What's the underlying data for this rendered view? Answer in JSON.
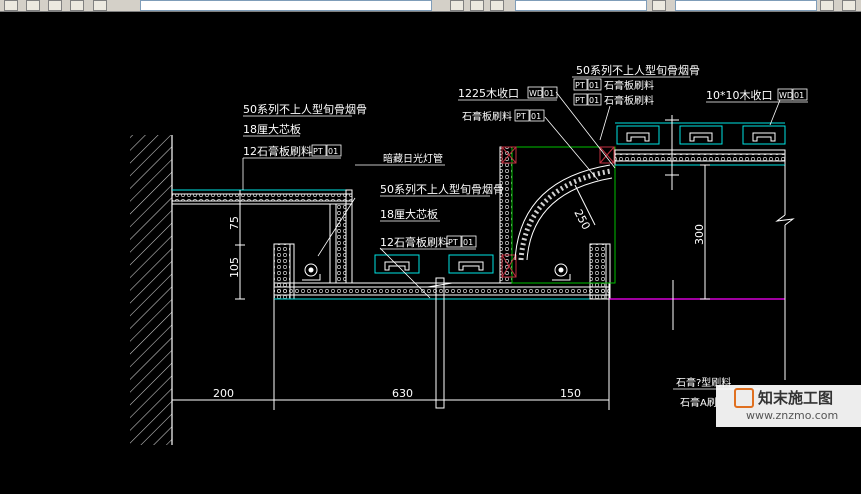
{
  "labels": {
    "left_keel": "50系列不上人型旬骨烟骨",
    "left_board": "18厘大芯板",
    "left_gypsum": "12石膏板刷料",
    "left_pt": "PT",
    "left_pt_no": "01",
    "hidden_lamp": "暗藏日光灯管",
    "center_keel": "50系列不上人型旬骨烟骨",
    "center_board": "18厘大芯板",
    "center_gypsum": "12石膏板刷料",
    "center_pt": "PT",
    "center_pt_no": "01",
    "wood_edge_1225": "1225木收口",
    "wd": "WD",
    "wd_no": "01",
    "gypsum_paint_mid": "石膏板刷料",
    "mid_pt": "PT",
    "mid_pt_no": "01",
    "right_keel": "50系列不上人型旬骨烟骨",
    "right_pt_a": "PT",
    "right_pt_a_no": "01",
    "right_gypsum_a": "石膏板刷料",
    "right_pt_b": "PT",
    "right_pt_b_no": "01",
    "right_gypsum_b": "石膏板刷料",
    "wood_edge_10x10": "10*10木收口",
    "wd2": "WD",
    "wd2_no": "01",
    "dim_75": "75",
    "dim_105": "105",
    "dim_250": "250",
    "dim_300": "300",
    "dim_200": "200",
    "dim_630": "630",
    "dim_150": "150",
    "gypsum_bottom_1": "石膏?型刷料",
    "gypsum_bottom_2": "石膏A刷"
  },
  "watermark": {
    "brand": "知末施工图",
    "url": "www.znzmo.com"
  },
  "colors": {
    "background": "#000000",
    "drawing_white": "#ffffff",
    "cyan": "#00e5e5",
    "green": "#00c000",
    "magenta": "#ff00ff",
    "annotation_box": "#ffffff"
  }
}
